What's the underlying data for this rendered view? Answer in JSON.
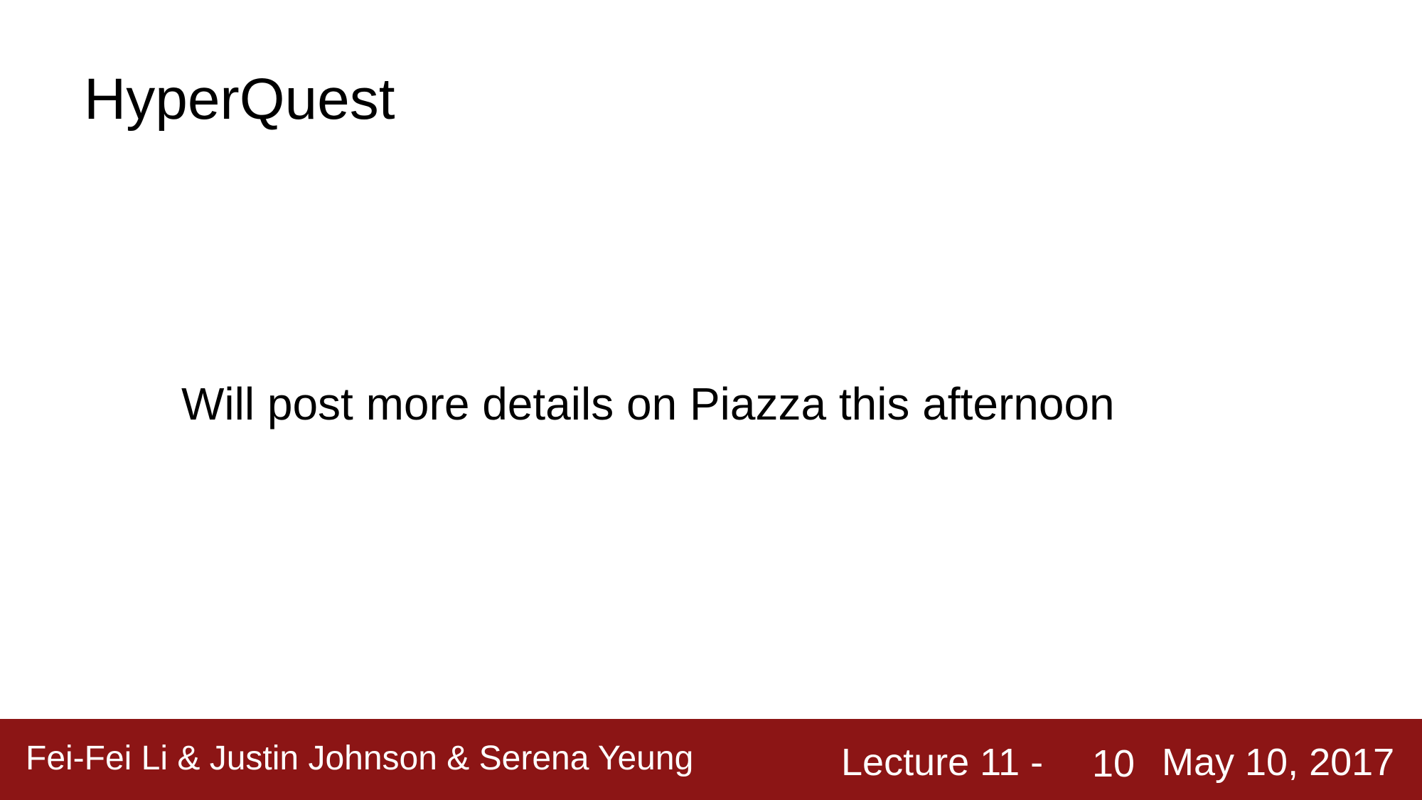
{
  "slide": {
    "title": "HyperQuest",
    "body": "Will post more details on Piazza this afternoon"
  },
  "footer": {
    "authors": "Fei-Fei Li & Justin Johnson & Serena Yeung",
    "lecture": "Lecture 11 -",
    "page_number": "10",
    "date": "May 10, 2017"
  },
  "colors": {
    "footer_background": "#8c1515",
    "footer_text": "#ffffff",
    "background": "#ffffff",
    "text": "#000000"
  }
}
